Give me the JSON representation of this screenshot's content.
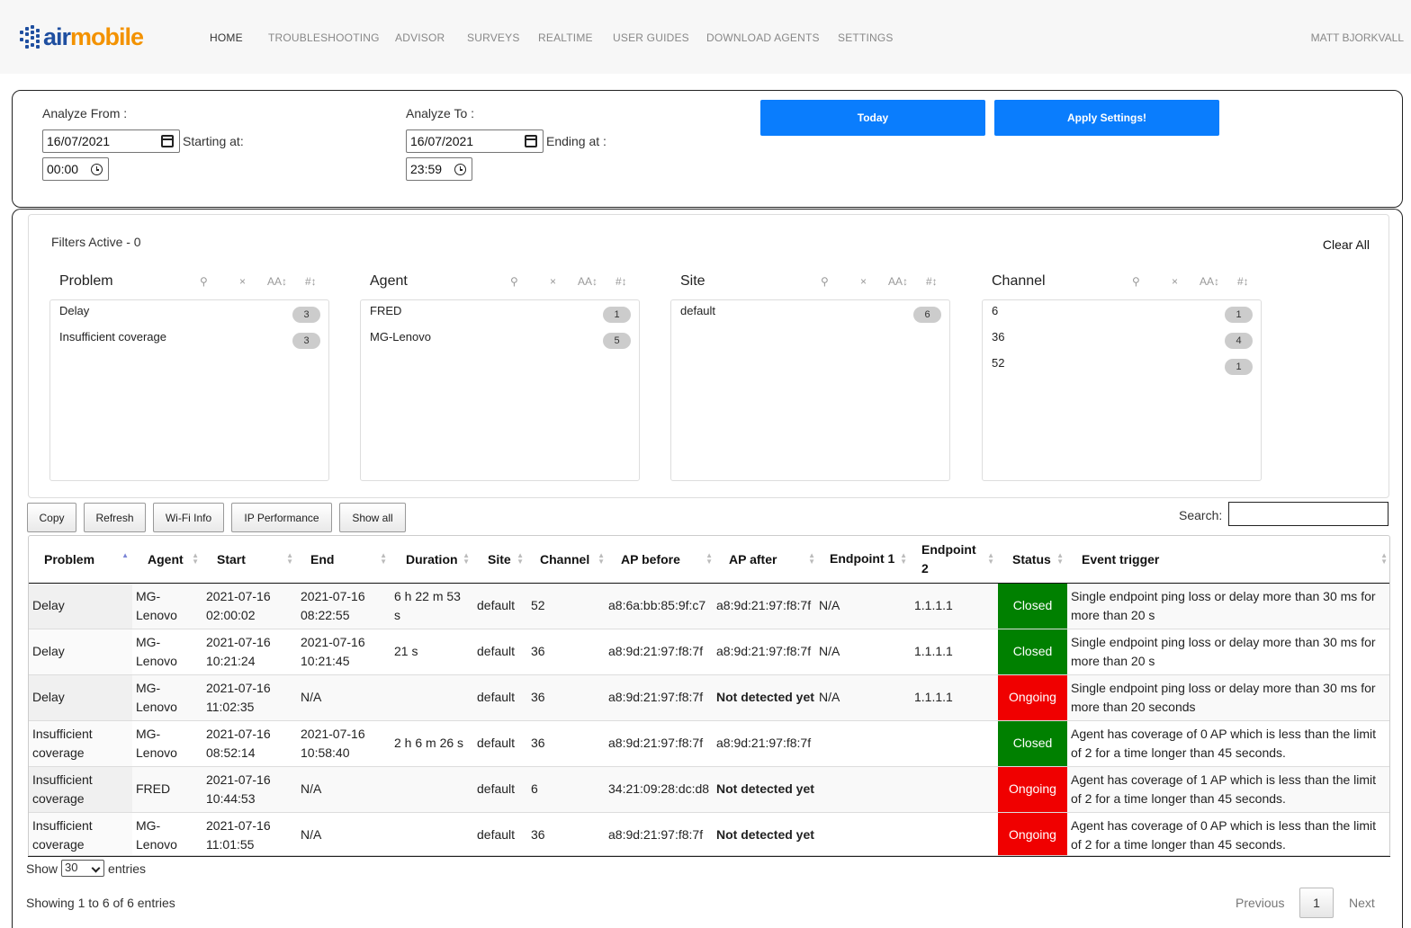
{
  "nav": {
    "logo_air": "air",
    "logo_mobile": "mobile",
    "items": [
      "HOME",
      "TROUBLESHOOTING",
      "ADVISOR",
      "SURVEYS",
      "REALTIME",
      "USER GUIDES",
      "DOWNLOAD AGENTS",
      "SETTINGS"
    ],
    "user": "MATT BJORKVALL"
  },
  "dates": {
    "from_label": "Analyze From :",
    "from_date": "16/07/2021",
    "starting_label": "Starting at:",
    "from_time": "00:00",
    "to_label": "Analyze To :",
    "to_date": "16/07/2021",
    "ending_label": "Ending at :",
    "to_time": "23:59",
    "today_button": "Today",
    "apply_button": "Apply Settings!"
  },
  "filters": {
    "active_label": "Filters Active - 0",
    "clear_all": "Clear All",
    "facets": [
      {
        "title": "Problem",
        "rows": [
          {
            "label": "Delay",
            "count": "3"
          },
          {
            "label": "Insufficient coverage",
            "count": "3"
          }
        ]
      },
      {
        "title": "Agent",
        "rows": [
          {
            "label": "FRED",
            "count": "1"
          },
          {
            "label": "MG-Lenovo",
            "count": "5"
          }
        ]
      },
      {
        "title": "Site",
        "rows": [
          {
            "label": "default",
            "count": "6"
          }
        ]
      },
      {
        "title": "Channel",
        "rows": [
          {
            "label": "6",
            "count": "1"
          },
          {
            "label": "36",
            "count": "4"
          },
          {
            "label": "52",
            "count": "1"
          }
        ]
      }
    ]
  },
  "toolbar": {
    "copy": "Copy",
    "refresh": "Refresh",
    "wifi_info": "Wi-Fi Info",
    "ip_performance": "IP Performance",
    "show_all": "Show all",
    "search_label": "Search:"
  },
  "table": {
    "headers": {
      "problem": "Problem",
      "agent": "Agent",
      "start": "Start",
      "end": "End",
      "duration": "Duration",
      "site": "Site",
      "channel": "Channel",
      "ap_before": "AP before",
      "ap_after": "AP after",
      "endpoint1": "Endpoint 1",
      "endpoint2": "Endpoint 2",
      "status": "Status",
      "event_trigger": "Event trigger"
    },
    "rows": [
      {
        "problem": "Delay",
        "agent": "MG-Lenovo",
        "start": "2021-07-16 02:00:02",
        "end": "2021-07-16 08:22:55",
        "duration": "6 h 22 m 53 s",
        "site": "default",
        "channel": "52",
        "ap_before": "a8:6a:bb:85:9f:c7",
        "ap_after": "a8:9d:21:97:f8:7f",
        "endpoint1": "N/A",
        "endpoint2": "1.1.1.1",
        "status": "Closed",
        "trigger": "Single endpoint ping loss or delay more than 30 ms for more than 20 s"
      },
      {
        "problem": "Delay",
        "agent": "MG-Lenovo",
        "start": "2021-07-16 10:21:24",
        "end": "2021-07-16 10:21:45",
        "duration": "21 s",
        "site": "default",
        "channel": "36",
        "ap_before": "a8:9d:21:97:f8:7f",
        "ap_after": "a8:9d:21:97:f8:7f",
        "endpoint1": "N/A",
        "endpoint2": "1.1.1.1",
        "status": "Closed",
        "trigger": "Single endpoint ping loss or delay more than 30 ms for more than 20 s"
      },
      {
        "problem": "Delay",
        "agent": "MG-Lenovo",
        "start": "2021-07-16 11:02:35",
        "end": "N/A",
        "duration": "",
        "site": "default",
        "channel": "36",
        "ap_before": "a8:9d:21:97:f8:7f",
        "ap_after": "Not detected yet",
        "endpoint1": "N/A",
        "endpoint2": "1.1.1.1",
        "status": "Ongoing",
        "trigger": "Single endpoint ping loss or delay more than 30 ms for more than 20 seconds"
      },
      {
        "problem": "Insufficient coverage",
        "agent": "MG-Lenovo",
        "start": "2021-07-16 08:52:14",
        "end": "2021-07-16 10:58:40",
        "duration": "2 h 6 m 26 s",
        "site": "default",
        "channel": "36",
        "ap_before": "a8:9d:21:97:f8:7f",
        "ap_after": "a8:9d:21:97:f8:7f",
        "endpoint1": "",
        "endpoint2": "",
        "status": "Closed",
        "trigger": "Agent has coverage of 0 AP which is less than the limit of 2 for a time longer than 45 seconds."
      },
      {
        "problem": "Insufficient coverage",
        "agent": "FRED",
        "start": "2021-07-16 10:44:53",
        "end": "N/A",
        "duration": "",
        "site": "default",
        "channel": "6",
        "ap_before": "34:21:09:28:dc:d8",
        "ap_after": "Not detected yet",
        "endpoint1": "",
        "endpoint2": "",
        "status": "Ongoing",
        "trigger": "Agent has coverage of 1 AP which is less than the limit of 2 for a time longer than 45 seconds."
      },
      {
        "problem": "Insufficient coverage",
        "agent": "MG-Lenovo",
        "start": "2021-07-16 11:01:55",
        "end": "N/A",
        "duration": "",
        "site": "default",
        "channel": "36",
        "ap_before": "a8:9d:21:97:f8:7f",
        "ap_after": "Not detected yet",
        "endpoint1": "",
        "endpoint2": "",
        "status": "Ongoing",
        "trigger": "Agent has coverage of 0 AP which is less than the limit of 2 for a time longer than 45 seconds."
      }
    ]
  },
  "footer": {
    "show_label": "Show",
    "page_size": "30",
    "entries_label": "entries",
    "showing": "Showing 1 to 6 of 6 entries",
    "previous": "Previous",
    "page": "1",
    "next": "Next"
  },
  "colors": {
    "accent_blue": "#0a7dfd",
    "status_closed": "#008000",
    "status_ongoing": "#f00000",
    "logo_blue": "#1f4fa0",
    "logo_orange": "#f39200"
  }
}
